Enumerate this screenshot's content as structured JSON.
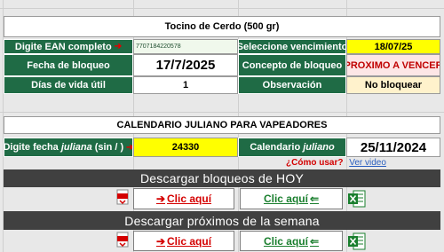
{
  "product_title": "Tocino de Cerdo (500 gr)",
  "block": {
    "ean_label": "Digite EAN completo",
    "ean_arrow": "➔",
    "ean_value": "7707184220578",
    "vencimiento_label": "Seleccione vencimiento",
    "vencimiento_value": "18/07/25",
    "fecha_bloqueo_label": "Fecha de bloqueo",
    "fecha_bloqueo_value": "17/7/2025",
    "concepto_label": "Concepto de bloqueo",
    "concepto_value": "PROXIMO A VENCER",
    "dias_label": "Días de vida útil",
    "dias_value": "1",
    "observacion_label": "Observación",
    "observacion_value": "No bloquear"
  },
  "juliano": {
    "title": "CALENDARIO JULIANO PARA VAPEADORES",
    "fecha_label_a": "Digite fecha ",
    "fecha_label_b": "juliana",
    "fecha_label_c": " (sin / )",
    "fecha_arrow": "➔",
    "fecha_value": "24330",
    "calendario_label_a": "Calendario ",
    "calendario_label_b": "juliano",
    "calendario_value": "25/11/2024",
    "help_question": "¿Cómo usar?",
    "help_link": "Ver video"
  },
  "downloads": {
    "today_title": "Descargar bloqueos de HOY",
    "week_title": "Descargar próximos de la semana",
    "pdf_label": "Clic aquí",
    "excel_label": "Clic aquí",
    "pdf_arrow": "➔",
    "excel_arrow": "⇐",
    "pdf_icon_text": "PDF",
    "excel_icon_text": "X"
  },
  "colors": {
    "header_green": "#1f6b45",
    "highlight_yellow": "#ffff00",
    "bar_dark": "#404040",
    "alert_red": "#d40000",
    "excel_green": "#1a7f2e"
  }
}
